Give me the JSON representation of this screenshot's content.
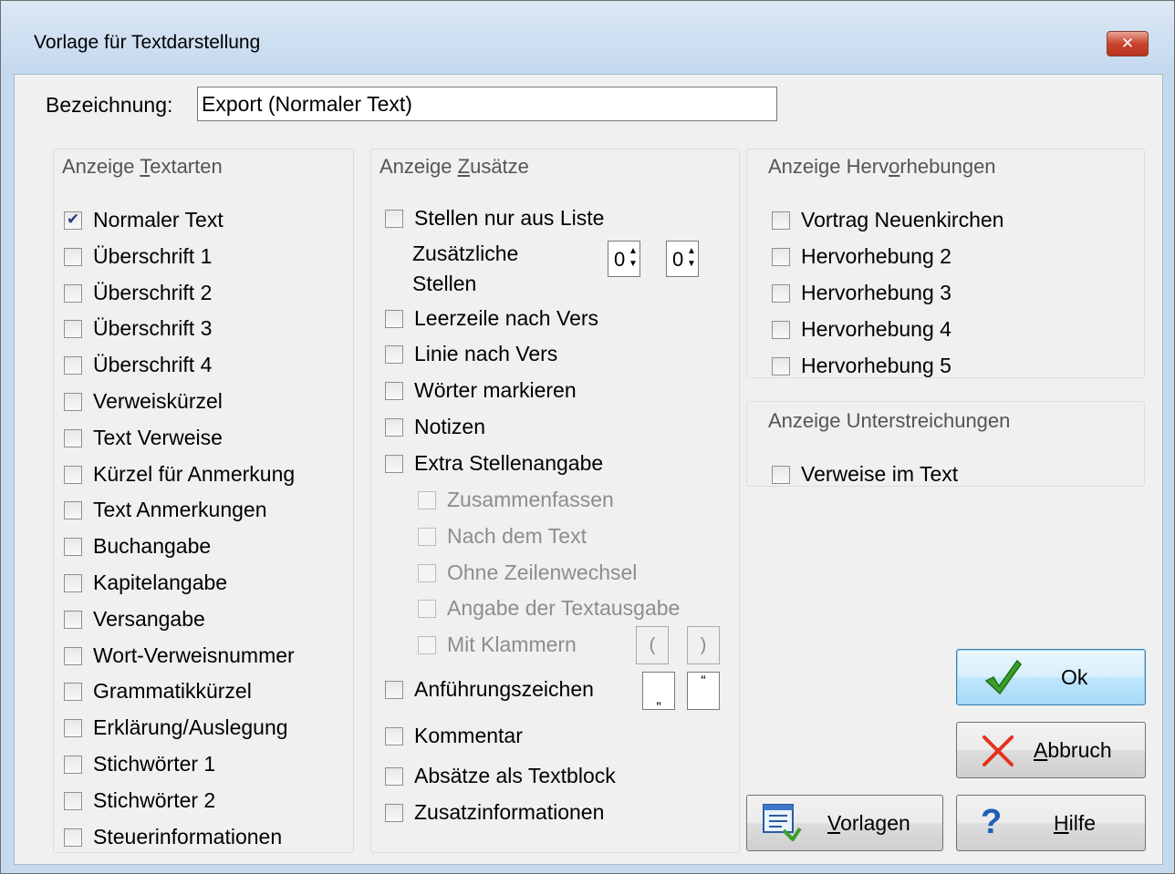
{
  "window": {
    "title": "Vorlage für Textdarstellung",
    "close_glyph": "✕"
  },
  "bezeichnung": {
    "label": "Bezeichnung:",
    "value": "Export (Normaler Text)"
  },
  "textarten": {
    "title": "Anzeige Textarten",
    "items": [
      {
        "label": "Normaler Text",
        "checked": true
      },
      {
        "label": "Überschrift 1",
        "checked": false
      },
      {
        "label": "Überschrift 2",
        "checked": false
      },
      {
        "label": "Überschrift 3",
        "checked": false
      },
      {
        "label": "Überschrift 4",
        "checked": false
      },
      {
        "label": "Verweiskürzel",
        "checked": false
      },
      {
        "label": "Text Verweise",
        "checked": false
      },
      {
        "label": "Kürzel für Anmerkung",
        "checked": false
      },
      {
        "label": "Text Anmerkungen",
        "checked": false
      },
      {
        "label": "Buchangabe",
        "checked": false
      },
      {
        "label": "Kapitelangabe",
        "checked": false
      },
      {
        "label": "Versangabe",
        "checked": false
      },
      {
        "label": "Wort-Verweisnummer",
        "checked": false
      },
      {
        "label": "Grammatikkürzel",
        "checked": false
      },
      {
        "label": "Erklärung/Auslegung",
        "checked": false
      },
      {
        "label": "Stichwörter 1",
        "checked": false
      },
      {
        "label": "Stichwörter 2",
        "checked": false
      },
      {
        "label": "Steuerinformationen",
        "checked": false
      }
    ]
  },
  "zusaetze": {
    "title": "Anzeige Zusätze",
    "stellen_liste": "Stellen nur aus Liste",
    "zusaetzliche_1": "Zusätzliche",
    "zusaetzliche_2": "Stellen",
    "spin1": "0",
    "spin2": "0",
    "leerzeile": "Leerzeile nach Vers",
    "linie": "Linie nach Vers",
    "woerter": "Wörter markieren",
    "notizen": "Notizen",
    "extra": "Extra Stellenangabe",
    "zusammenfassen": "Zusammenfassen",
    "nach_text": "Nach dem Text",
    "ohne_zeilen": "Ohne Zeilenwechsel",
    "angabe_textausgabe": "Angabe der Textausgabe",
    "mit_klammern": "Mit Klammern",
    "klammer_auf": "(",
    "klammer_zu": ")",
    "anfuehrung": "Anführungszeichen",
    "quote_open": "„",
    "quote_close": "“",
    "kommentar": "Kommentar",
    "absaetze": "Absätze als Textblock",
    "zusatzinfo": "Zusatzinformationen"
  },
  "hervorhebungen": {
    "title": "Anzeige Hervorhebungen",
    "items": [
      "Vortrag Neuenkirchen",
      "Hervorhebung 2",
      "Hervorhebung 3",
      "Hervorhebung 4",
      "Hervorhebung 5"
    ]
  },
  "unterstreichungen": {
    "title": "Anzeige Unterstreichungen",
    "item": "Verweise im Text"
  },
  "buttons": {
    "ok": "Ok",
    "abbruch": "Abbruch",
    "vorlagen": "Vorlagen",
    "hilfe": "Hilfe"
  },
  "icons": {
    "ok": "check-icon",
    "abbruch": "cross-icon",
    "vorlagen": "list-icon",
    "hilfe": "question-icon"
  },
  "colors": {
    "check_green": "#3aa02a",
    "cross_red": "#e5321c",
    "help_blue": "#1f5fb8"
  }
}
